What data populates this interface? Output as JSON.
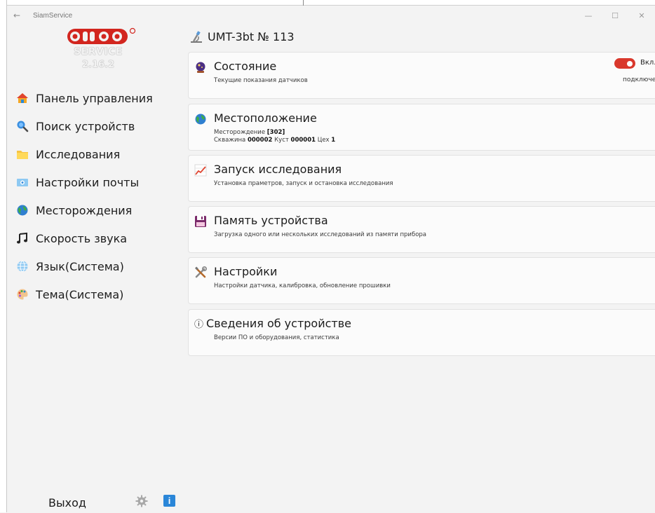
{
  "window": {
    "title": "SiamService",
    "back_glyph": "←",
    "min_glyph": "—",
    "max_glyph": "☐",
    "close_glyph": "✕"
  },
  "logo": {
    "service_text": "SERVICE",
    "version": "2.16.2"
  },
  "nav": [
    {
      "label": "Панель управления",
      "icon": "house-icon"
    },
    {
      "label": "Поиск устройств",
      "icon": "magnifier-icon"
    },
    {
      "label": "Исследования",
      "icon": "folder-icon"
    },
    {
      "label": "Настройки почты",
      "icon": "mail-icon"
    },
    {
      "label": "Месторождения",
      "icon": "globe-icon"
    },
    {
      "label": "Скорость звука",
      "icon": "music-notes-icon"
    },
    {
      "label": "Язык(Система)",
      "icon": "language-globe-icon"
    },
    {
      "label": "Тема(Система)",
      "icon": "palette-icon"
    }
  ],
  "footer": {
    "exit_label": "Выход",
    "info_glyph": "i"
  },
  "device": {
    "name": "UMT-3bt № 113"
  },
  "cards": {
    "status": {
      "title": "Состояние",
      "subtitle": "Текущие показания датчиков",
      "toggle_label": "Вкл.",
      "toggle_on": true,
      "connection": "подключен"
    },
    "location": {
      "title": "Местоположение",
      "field_prefix": "Месторождение ",
      "field_value": "[302]",
      "well_prefix": "Скважина ",
      "well_value": "000002",
      "bush_prefix": " Куст ",
      "bush_value": "000001",
      "shop_prefix": " Цех ",
      "shop_value": "1"
    },
    "launch": {
      "title": "Запуск исследования",
      "subtitle": "Установка праметров, запуск и остановка исследования"
    },
    "memory": {
      "title": "Память устройства",
      "subtitle": "Загрузка одного или нескольких исследований из памяти прибора"
    },
    "settings": {
      "title": "Настройки",
      "subtitle": "Настройки датчика, калибровка, обновление прошивки"
    },
    "about": {
      "title": "Сведения об устройстве",
      "subtitle": "Версии ПО и оборудования, статистика",
      "glyph": "ⓘ"
    }
  },
  "colors": {
    "accent_red": "#d9382c",
    "info_blue": "#2a86d8",
    "background": "#f3f3f3",
    "card": "#fbfbfb"
  }
}
